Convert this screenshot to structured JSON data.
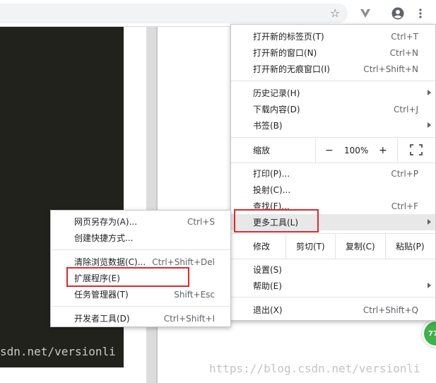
{
  "toolbar": {
    "icons": [
      "star-icon",
      "extension-v-icon",
      "profile-icon",
      "kebab-menu-icon"
    ]
  },
  "background": {
    "left_watermark": "sdn.net/versionli",
    "bottom_watermark": "https://blog.csdn.net/versionli",
    "badge_text": "77"
  },
  "main_menu": {
    "new_tab": {
      "label": "打开新的标签页(T)",
      "shortcut": "Ctrl+T"
    },
    "new_window": {
      "label": "打开新的窗口(N)",
      "shortcut": "Ctrl+N"
    },
    "new_incognito": {
      "label": "打开新的无痕窗口(I)",
      "shortcut": "Ctrl+Shift+N"
    },
    "history": {
      "label": "历史记录(H)"
    },
    "downloads": {
      "label": "下载内容(D)",
      "shortcut": "Ctrl+J"
    },
    "bookmarks": {
      "label": "书签(B)"
    },
    "zoom": {
      "label": "缩放",
      "minus": "−",
      "value": "100%",
      "plus": "+"
    },
    "print": {
      "label": "打印(P)...",
      "shortcut": "Ctrl+P"
    },
    "cast": {
      "label": "投射(C)..."
    },
    "find": {
      "label": "查找(F)...",
      "shortcut": "Ctrl+F"
    },
    "more_tools": {
      "label": "更多工具(L)"
    },
    "edit": {
      "label": "修改",
      "cut": "剪切(T)",
      "copy": "复制(C)",
      "paste": "粘贴(P)"
    },
    "settings": {
      "label": "设置(S)"
    },
    "help": {
      "label": "帮助(E)"
    },
    "exit": {
      "label": "退出(X)",
      "shortcut": "Ctrl+Shift+Q"
    }
  },
  "sub_menu": {
    "save_page": {
      "label": "网页另存为(A)...",
      "shortcut": "Ctrl+S"
    },
    "create_shortcut": {
      "label": "创建快捷方式..."
    },
    "clear_data": {
      "label": "清除浏览数据(C)...",
      "shortcut": "Ctrl+Shift+Del"
    },
    "extensions": {
      "label": "扩展程序(E)"
    },
    "task_manager": {
      "label": "任务管理器(T)",
      "shortcut": "Shift+Esc"
    },
    "devtools": {
      "label": "开发者工具(D)",
      "shortcut": "Ctrl+Shift+I"
    }
  },
  "colors": {
    "highlight_box": "#e0262d",
    "hover_bg": "#e8e8e8",
    "dark_panel": "#22221d"
  }
}
